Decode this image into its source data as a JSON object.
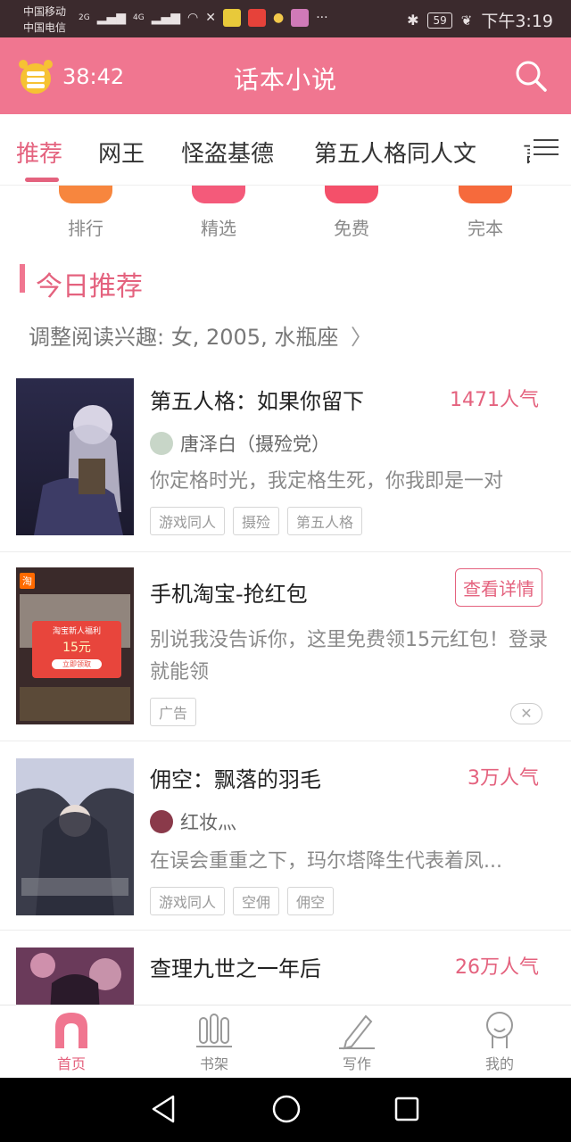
{
  "status_bar": {
    "carrier_1": "中国移动",
    "carrier_2": "中国电信",
    "net_1": "2G",
    "net_2": "4G",
    "battery": "59",
    "time": "下午3:19"
  },
  "header": {
    "timer": "38:42",
    "title": "话本小说",
    "accent": "#f07690"
  },
  "tabs": {
    "items": [
      "推荐",
      "网王",
      "怪盗基德",
      "第五人格同人文"
    ],
    "clipped": "言",
    "active_index": 0
  },
  "categories": [
    {
      "label": "排行",
      "color": "#f7863e"
    },
    {
      "label": "精选",
      "color": "#f45a7a"
    },
    {
      "label": "免费",
      "color": "#f4506a"
    },
    {
      "label": "完本",
      "color": "#f66a3c"
    }
  ],
  "section": {
    "title": "今日推荐",
    "interest_prefix": "调整阅读兴趣:",
    "interest_value": "女, 2005, 水瓶座"
  },
  "books": [
    {
      "title": "第五人格：如果你留下",
      "popularity": "1471人气",
      "author": "唐泽白（摄殓党）",
      "desc": "你定格时光，我定格生死，你我即是一对",
      "tags": [
        "游戏同人",
        "摄殓",
        "第五人格"
      ]
    },
    {
      "title": "佣空：飘落的羽毛",
      "popularity": "3万人气",
      "author": "红妆灬",
      "desc": "在误会重重之下，玛尔塔降生代表着凤...",
      "tags": [
        "游戏同人",
        "空佣",
        "佣空"
      ]
    },
    {
      "title": "查理九世之一年后",
      "popularity": "26万人气"
    }
  ],
  "ad": {
    "title": "手机淘宝-抢红包",
    "button": "查看详情",
    "desc": "别说我没告诉你，这里免费领15元红包！登录就能领",
    "tag": "广告",
    "close": "✕",
    "cover_tag": "淘",
    "cover_text": "淘宝新人福利",
    "cover_amount": "15元",
    "cover_button": "立即领取"
  },
  "bottom_nav": [
    {
      "label": "首页",
      "active": true
    },
    {
      "label": "书架",
      "active": false
    },
    {
      "label": "写作",
      "active": false
    },
    {
      "label": "我的",
      "active": false
    }
  ]
}
